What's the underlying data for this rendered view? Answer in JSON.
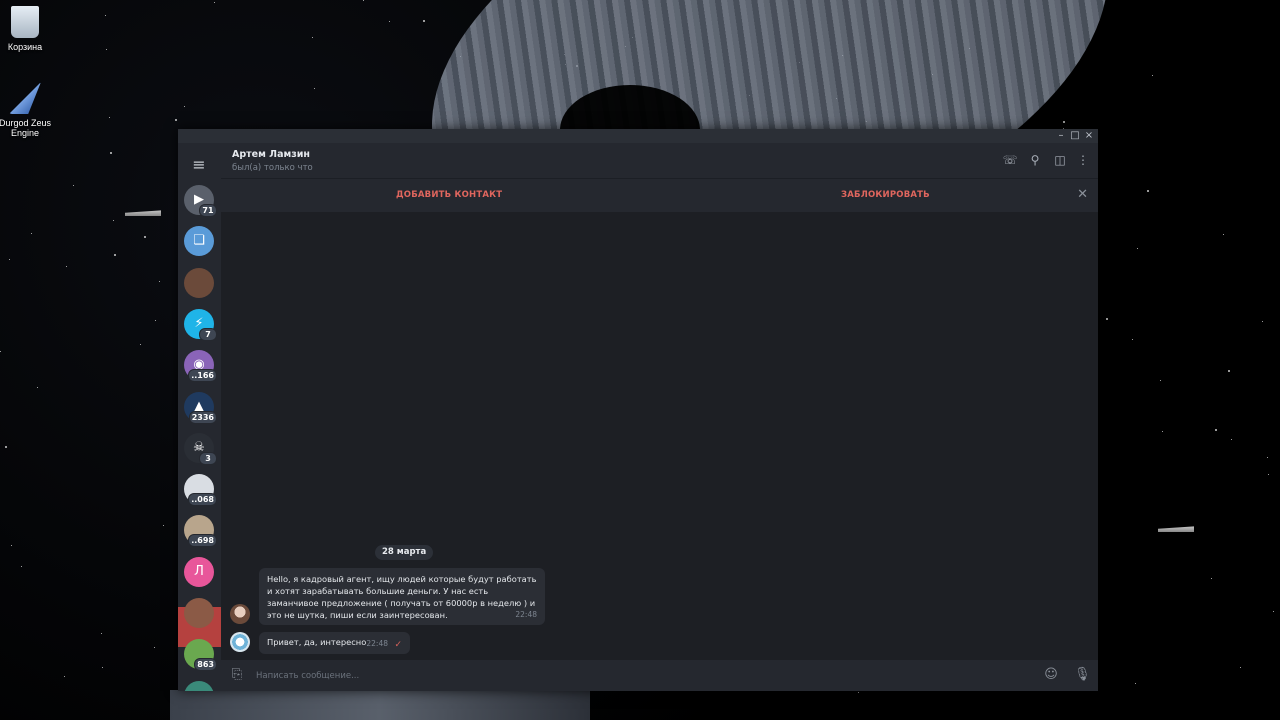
{
  "desktop": {
    "icons": [
      {
        "label": "Корзина"
      },
      {
        "label": "Durgod Zeus Engine"
      }
    ]
  },
  "window": {
    "controls": {
      "minimize": "–",
      "maximize": "□",
      "close": "×"
    },
    "sidebar": {
      "menu_icon": "≡",
      "chats": [
        {
          "badge": "71",
          "color": "#5a606b",
          "glyph": "▶"
        },
        {
          "badge": "",
          "color": "#5a9bd8",
          "glyph": "❏"
        },
        {
          "badge": "",
          "color": "#6b4a3a",
          "glyph": ""
        },
        {
          "badge": "7",
          "color": "#1fb4e8",
          "glyph": "⚡"
        },
        {
          "badge": "..166",
          "color": "#8a64b8",
          "glyph": "◉"
        },
        {
          "badge": "2336",
          "color": "#1f3a5f",
          "glyph": "▲"
        },
        {
          "badge": "3",
          "color": "#2a2e35",
          "glyph": "☠"
        },
        {
          "badge": "..068",
          "color": "#d9dde3",
          "glyph": ""
        },
        {
          "badge": "..698",
          "color": "#b8a58c",
          "glyph": ""
        },
        {
          "badge": "",
          "color": "#e8569a",
          "glyph": "Л"
        },
        {
          "badge": "",
          "color": "#8b5a46",
          "glyph": ""
        },
        {
          "badge": "863",
          "color": "#6aa84f",
          "glyph": ""
        },
        {
          "badge": "",
          "color": "#3a8a7a",
          "glyph": ""
        }
      ]
    },
    "header": {
      "name": "Артем Ламзин",
      "status": "был(а) только что"
    },
    "action_bar": {
      "add_contact": "ДОБАВИТЬ КОНТАКТ",
      "block": "ЗАБЛОКИРОВАТЬ"
    },
    "messages": {
      "date": "28 марта",
      "items": [
        {
          "text": "Hello, я кадровый агент, ищу людей которые будут работать и хотят зарабатывать большие деньги.  У нас есть заманчивое предложение ( получать от 60000р в неделю ) и это не шутка, пиши если заинтересован.",
          "time": "22:48"
        },
        {
          "text": "Привет, да, интересно",
          "time": "22:48",
          "read_mark": "✓"
        }
      ]
    },
    "composer": {
      "placeholder": "Написать сообщение..."
    }
  }
}
